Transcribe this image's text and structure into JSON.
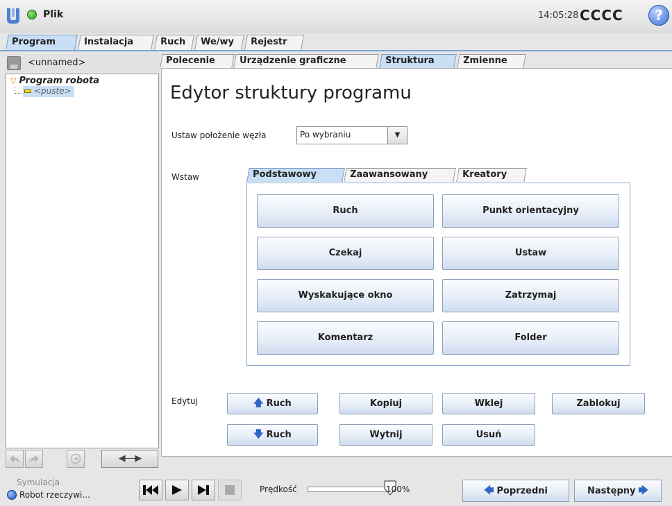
{
  "header": {
    "file_label": "Plik",
    "clock": "14:05:28",
    "robot_name": "CCCC",
    "help_glyph": "?"
  },
  "main_tabs": [
    {
      "label": "Program",
      "active": true
    },
    {
      "label": "Instalacja",
      "active": false
    },
    {
      "label": "Ruch",
      "active": false
    },
    {
      "label": "We/wy",
      "active": false
    },
    {
      "label": "Rejestr",
      "active": false
    }
  ],
  "left_panel": {
    "program_name": "<unnamed>",
    "tree": {
      "root": "Program robota",
      "child": "<puste>"
    },
    "move_label": "◀----▶"
  },
  "sub_tabs": [
    {
      "label": "Polecenie",
      "active": false
    },
    {
      "label": "Urządzenie graficzne",
      "active": false
    },
    {
      "label": "Struktura",
      "active": true
    },
    {
      "label": "Zmienne",
      "active": false
    }
  ],
  "editor": {
    "title": "Edytor struktury programu",
    "node_position_label": "Ustaw położenie węzła",
    "node_position_value": "Po wybraniu",
    "insert_label": "Wstaw",
    "insert_tabs": [
      {
        "label": "Podstawowy",
        "active": true
      },
      {
        "label": "Zaawansowany",
        "active": false
      },
      {
        "label": "Kreatory",
        "active": false
      }
    ],
    "insert_buttons": [
      "Ruch",
      "Punkt orientacyjny",
      "Czekaj",
      "Ustaw",
      "Wyskakujące okno",
      "Zatrzymaj",
      "Komentarz",
      "Folder"
    ],
    "edit_label": "Edytuj",
    "edit_buttons": {
      "move_up": "Ruch",
      "copy": "Kopiuj",
      "paste": "Wklej",
      "lock": "Zablokuj",
      "move_down": "Ruch",
      "cut": "Wytnij",
      "delete": "Usuń"
    }
  },
  "bottom": {
    "simulation_label": "Symulacja",
    "real_robot_label": "Robot rzeczywi...",
    "speed_label": "Prędkość",
    "speed_value": "100%",
    "speed_fraction": 1.0,
    "prev_label": "Poprzedni",
    "next_label": "Następny"
  },
  "colors": {
    "active_tab": "#c9dff6",
    "accent_blue": "#2f66c4",
    "tree_child_icon": "#ffe100"
  }
}
